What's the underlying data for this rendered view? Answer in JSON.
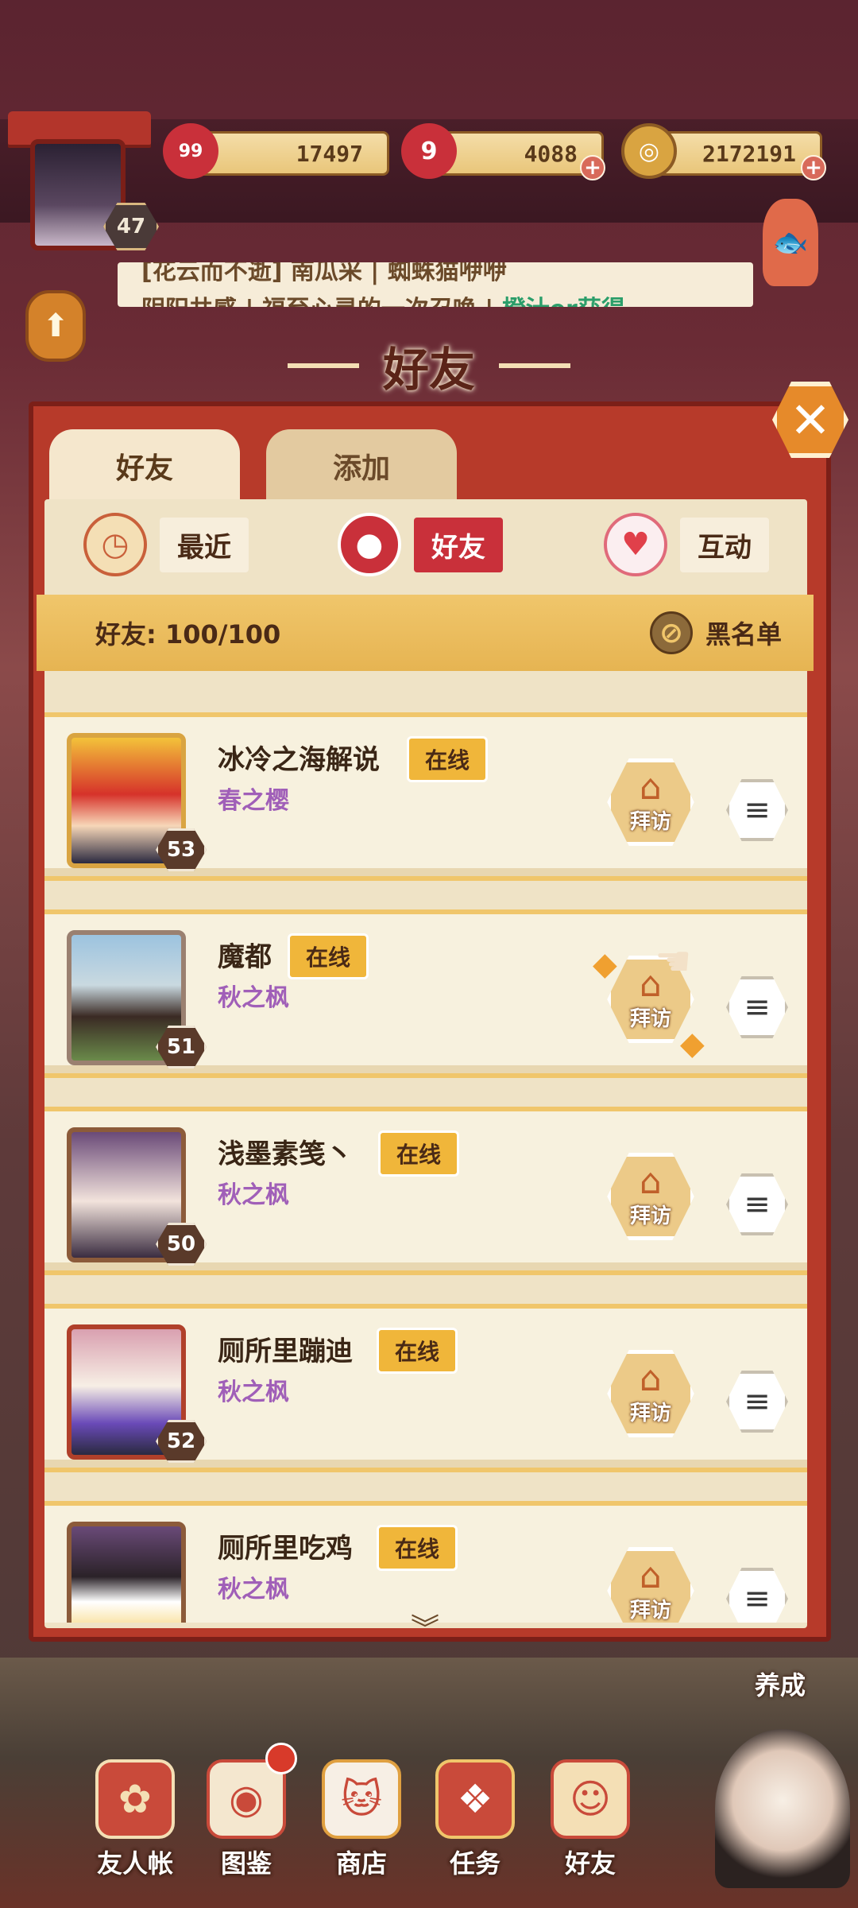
{
  "player": {
    "level": "47"
  },
  "resources": [
    {
      "name": "jade",
      "value": "17497",
      "icon_badge": "99",
      "icon": "flower-coin-icon",
      "color": "#c9303a"
    },
    {
      "name": "stamina",
      "value": "4088",
      "icon_badge": "9",
      "icon": "spiral-stamina-icon",
      "color": "#c9303a"
    },
    {
      "name": "gold",
      "value": "2172191",
      "icon": "coin-icon",
      "color": "#d9a441"
    }
  ],
  "ticker": {
    "line1": "[花云而不逝] 南瓜采 | 蜘蛛猫咿咿",
    "line2_prefix": "阴阳共感 | 福至心灵的一次召唤 |",
    "line2_highlight": "橙汁er获得"
  },
  "title": "好友",
  "tabs": {
    "friends": "好友",
    "add": "添加"
  },
  "subtabs": {
    "recent": "最近",
    "friends": "好友",
    "interact": "互动"
  },
  "count_bar": {
    "label": "好友: 100/100",
    "blacklist": "黑名单"
  },
  "friends": [
    {
      "name": "冰冷之海解说",
      "status": "在线",
      "server": "春之樱",
      "level": "53",
      "visit": "拜访"
    },
    {
      "name": "魔都",
      "status": "在线",
      "server": "秋之枫",
      "level": "51",
      "visit": "拜访"
    },
    {
      "name": "浅墨素笺丶",
      "status": "在线",
      "server": "秋之枫",
      "level": "50",
      "visit": "拜访"
    },
    {
      "name": "厕所里蹦迪",
      "status": "在线",
      "server": "秋之枫",
      "level": "52",
      "visit": "拜访"
    },
    {
      "name": "厕所里吃鸡",
      "status": "在线",
      "server": "秋之枫",
      "level": "",
      "visit": "拜访"
    }
  ],
  "bottom_nav": {
    "raise": "养成",
    "items": [
      "友人帐",
      "图鉴",
      "商店",
      "任务",
      "好友"
    ]
  },
  "colors": {
    "accent": "#c9303a",
    "panel": "#b73a2a",
    "gold": "#f0c66b",
    "server": "#a05fb8"
  }
}
